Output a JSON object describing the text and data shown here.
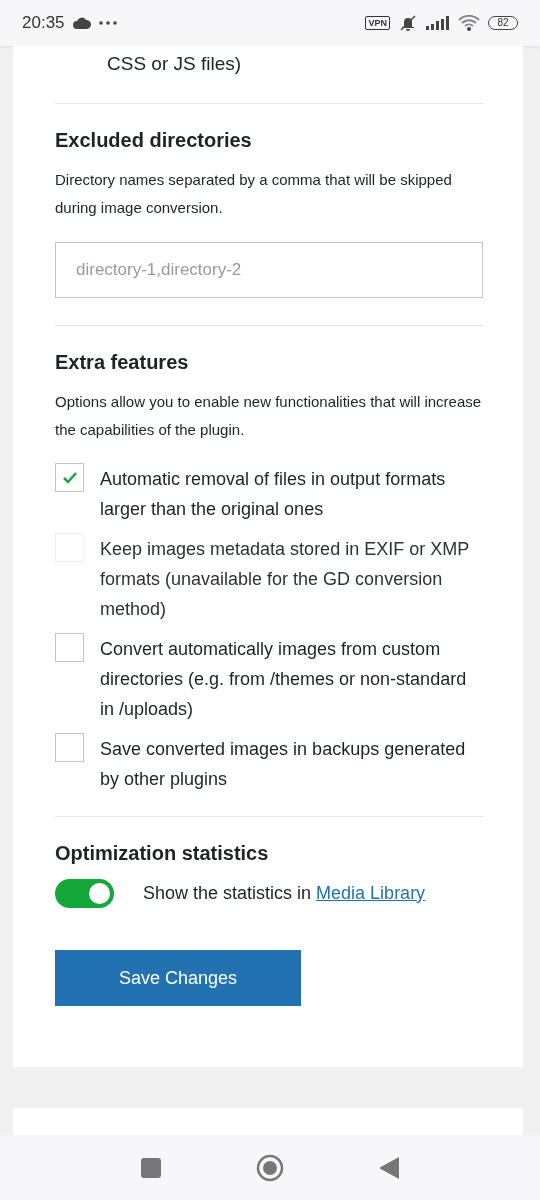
{
  "status_bar": {
    "time": "20:35",
    "vpn": "VPN",
    "battery": "82"
  },
  "continued_text": "CSS or JS files)",
  "excluded": {
    "title": "Excluded directories",
    "description": "Directory names separated by a comma that will be skipped during image conversion.",
    "placeholder": "directory-1,directory-2"
  },
  "extra": {
    "title": "Extra features",
    "description": "Options allow you to enable new functionalities that will increase the capabilities of the plugin.",
    "options": [
      {
        "label": "Automatic removal of files in output formats larger than the original ones",
        "checked": true,
        "disabled": false
      },
      {
        "label": "Keep images metadata stored in EXIF or XMP formats (unavailable for the GD conversion method)",
        "checked": false,
        "disabled": true
      },
      {
        "label": "Convert automatically images from custom directories (e.g. from /themes or non-standard in /uploads)",
        "checked": false,
        "disabled": false
      },
      {
        "label": "Save converted images in backups generated by other plugins",
        "checked": false,
        "disabled": false
      }
    ]
  },
  "stats": {
    "title": "Optimization statistics",
    "on": true,
    "text": "Show the statistics in ",
    "link": "Media Library"
  },
  "save_button": "Save Changes"
}
